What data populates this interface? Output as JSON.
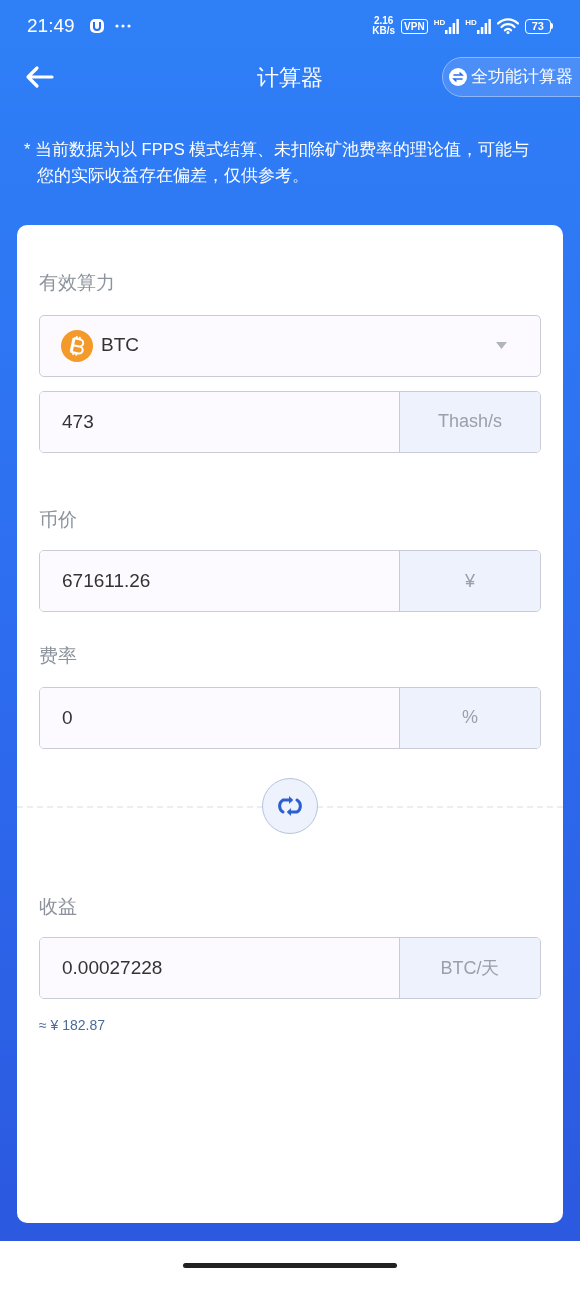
{
  "status_bar": {
    "time": "21:49",
    "speed_value": "2.16",
    "speed_unit": "KB/s",
    "vpn": "VPN",
    "sim_labels": [
      "HD",
      "HD"
    ],
    "battery": "73"
  },
  "header": {
    "title": "计算器",
    "action": "全功能计算器"
  },
  "note": "* 当前数据为以 FPPS 模式结算、未扣除矿池费率的理论值，可能与您的实际收益存在偏差，仅供参考。",
  "hashrate": {
    "label": "有效算力",
    "coin": "BTC",
    "value": "473",
    "unit": "Thash/s"
  },
  "price": {
    "label": "币价",
    "value": "671611.26",
    "unit": "¥"
  },
  "fee": {
    "label": "费率",
    "value": "0",
    "unit": "%"
  },
  "income": {
    "label": "收益",
    "value": "0.00027228",
    "unit": "BTC/天",
    "approx": "≈ ¥ 182.87"
  }
}
